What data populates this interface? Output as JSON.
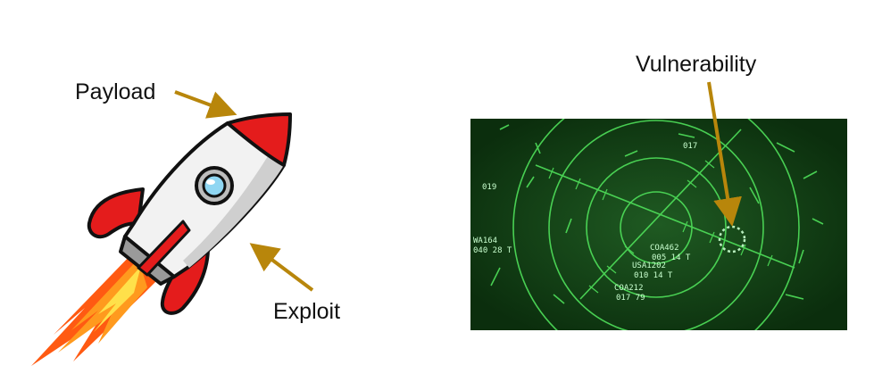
{
  "labels": {
    "payload": "Payload",
    "exploit": "Exploit",
    "vulnerability": "Vulnerability"
  },
  "radar_text": {
    "t1": "COA462",
    "t2": "005 14 T",
    "t3": "USA1202",
    "t4": "010 14 T",
    "t5": "COA212",
    "t6": "017 79",
    "t7": "019",
    "t8": "017",
    "t9": "WA164",
    "t10": "040 28 T"
  },
  "colors": {
    "arrow": "#b8860b",
    "radar_bg": "#0f3f12",
    "radar_line": "#4fe05a",
    "rocket_red": "#e41c1c",
    "rocket_body": "#f2f2f2"
  }
}
